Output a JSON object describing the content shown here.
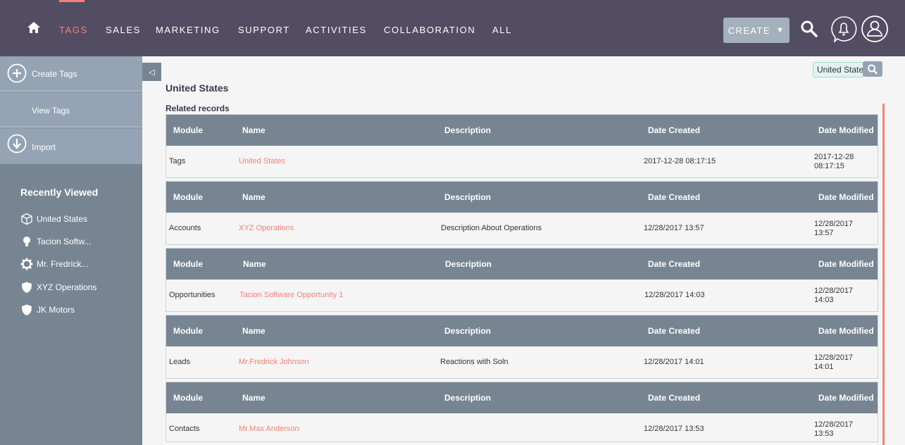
{
  "nav": {
    "items": [
      {
        "label": "TAGS",
        "active": true
      },
      {
        "label": "SALES"
      },
      {
        "label": "MARKETING"
      },
      {
        "label": "SUPPORT"
      },
      {
        "label": "ACTIVITIES"
      },
      {
        "label": "COLLABORATION"
      },
      {
        "label": "ALL"
      }
    ],
    "create_label": "CREATE",
    "icons": {
      "home": "home-icon",
      "search": "search-icon",
      "notifications": "bell-icon",
      "user": "user-icon"
    }
  },
  "sidebar": {
    "actions": [
      {
        "label": "Create Tags",
        "icon": "plus-circle-icon"
      },
      {
        "label": "View Tags"
      },
      {
        "label": "Import",
        "icon": "download-circle-icon"
      }
    ],
    "recent_title": "Recently Viewed",
    "recent": [
      {
        "label": "United States",
        "icon": "cube-icon"
      },
      {
        "label": "Tacion Softw...",
        "icon": "lightbulb-icon"
      },
      {
        "label": "Mr. Fredrick...",
        "icon": "gear-icon"
      },
      {
        "label": "XYZ Operations",
        "icon": "shield-icon"
      },
      {
        "label": "JK Motors",
        "icon": "shield-icon"
      }
    ]
  },
  "search": {
    "value": "United States"
  },
  "page": {
    "title": "United States",
    "related_label": "Related records"
  },
  "columns": {
    "module": "Module",
    "name": "Name",
    "description": "Description",
    "date_created": "Date Created",
    "date_modified": "Date Modified"
  },
  "records": [
    {
      "module": "Tags",
      "name": "United States",
      "description": "",
      "date_created": "2017-12-28 08:17:15",
      "date_modified_date": "2017-12-28",
      "date_modified_time": "08:17:15"
    },
    {
      "module": "Accounts",
      "name": "XYZ Operations",
      "description": "Description About Operations",
      "date_created": "12/28/2017 13:57",
      "date_modified_date": "12/28/2017",
      "date_modified_time": "13:57"
    },
    {
      "module": "Opportunities",
      "name": "Tacion Software Opportunity 1",
      "description": "",
      "date_created": "12/28/2017 14:03",
      "date_modified_date": "12/28/2017",
      "date_modified_time": "14:03"
    },
    {
      "module": "Leads",
      "name": "Mr.Fredrick Johnson",
      "description": "Reactions with Soln",
      "date_created": "12/28/2017 14:01",
      "date_modified_date": "12/28/2017",
      "date_modified_time": "14:01"
    },
    {
      "module": "Contacts",
      "name": "Mr.Max Anderson",
      "description": "",
      "date_created": "12/28/2017 13:53",
      "date_modified_date": "12/28/2017",
      "date_modified_time": "13:53"
    }
  ],
  "colors": {
    "nav_bg": "#534d64",
    "accent": "#f08377",
    "sidebar_bg": "#778593",
    "sidebar_action_bg": "#94a4b5",
    "table_header_bg": "#778593"
  }
}
